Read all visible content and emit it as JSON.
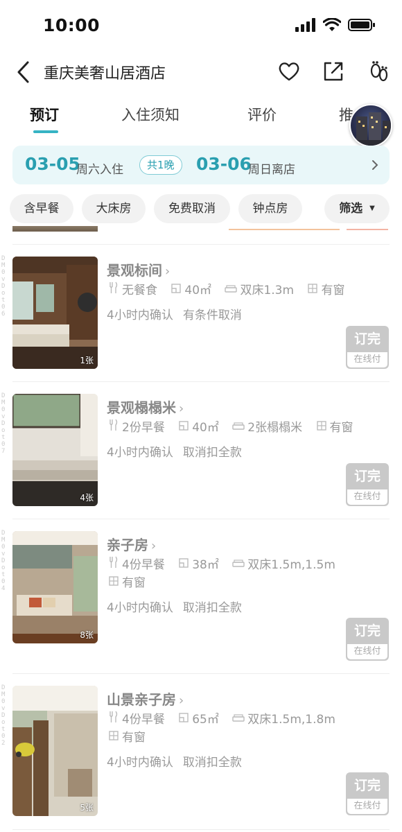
{
  "status": {
    "time": "10:00"
  },
  "nav": {
    "title": "重庆美奢山居酒店",
    "icons": [
      "back-icon",
      "favorite-icon",
      "share-icon",
      "footprint-icon"
    ]
  },
  "tabs": [
    {
      "label": "预订",
      "active": true
    },
    {
      "label": "入住须知",
      "active": false
    },
    {
      "label": "评价",
      "active": false
    },
    {
      "label": "推",
      "active": false
    }
  ],
  "dates": {
    "checkin_date": "03-05",
    "checkin_label": "周六入住",
    "nights": "共1晚",
    "checkout_date": "03-06",
    "checkout_label": "周日离店"
  },
  "filters": [
    "含早餐",
    "大床房",
    "免费取消",
    "钟点房"
  ],
  "filter_button": "筛选",
  "rooms": [
    {
      "trace": "DM0vDot06",
      "name": "景观标间",
      "meal": "无餐食",
      "area": "40㎡",
      "bed": "双床1.3m",
      "window": "有窗",
      "confirm": "4小时内确认",
      "cancel": "有条件取消",
      "img_count": "1张",
      "book_status": "订完",
      "book_sub": "在线付"
    },
    {
      "trace": "DM0vDot07",
      "name": "景观榻榻米",
      "meal": "2份早餐",
      "area": "40㎡",
      "bed": "2张榻榻米",
      "window": "有窗",
      "confirm": "4小时内确认",
      "cancel": "取消扣全款",
      "img_count": "4张",
      "book_status": "订完",
      "book_sub": "在线付"
    },
    {
      "trace": "DM0vDot04",
      "name": "亲子房",
      "meal": "4份早餐",
      "area": "38㎡",
      "bed": "双床1.5m,1.5m",
      "window": "有窗",
      "confirm": "4小时内确认",
      "cancel": "取消扣全款",
      "img_count": "8张",
      "book_status": "订完",
      "book_sub": "在线付"
    },
    {
      "trace": "DM0vDot02",
      "name": "山景亲子房",
      "meal": "4份早餐",
      "area": "65㎡",
      "bed": "双床1.5m,1.8m",
      "window": "有窗",
      "confirm": "4小时内确认",
      "cancel": "取消扣全款",
      "img_count": "5张",
      "book_status": "订完",
      "book_sub": "在线付"
    }
  ],
  "colors": {
    "accent": "#2a9fb0",
    "date_bar_bg": "#e9f7f9",
    "chip_bg": "#f2f2f2",
    "soldout_bg": "#c9c9c9"
  }
}
